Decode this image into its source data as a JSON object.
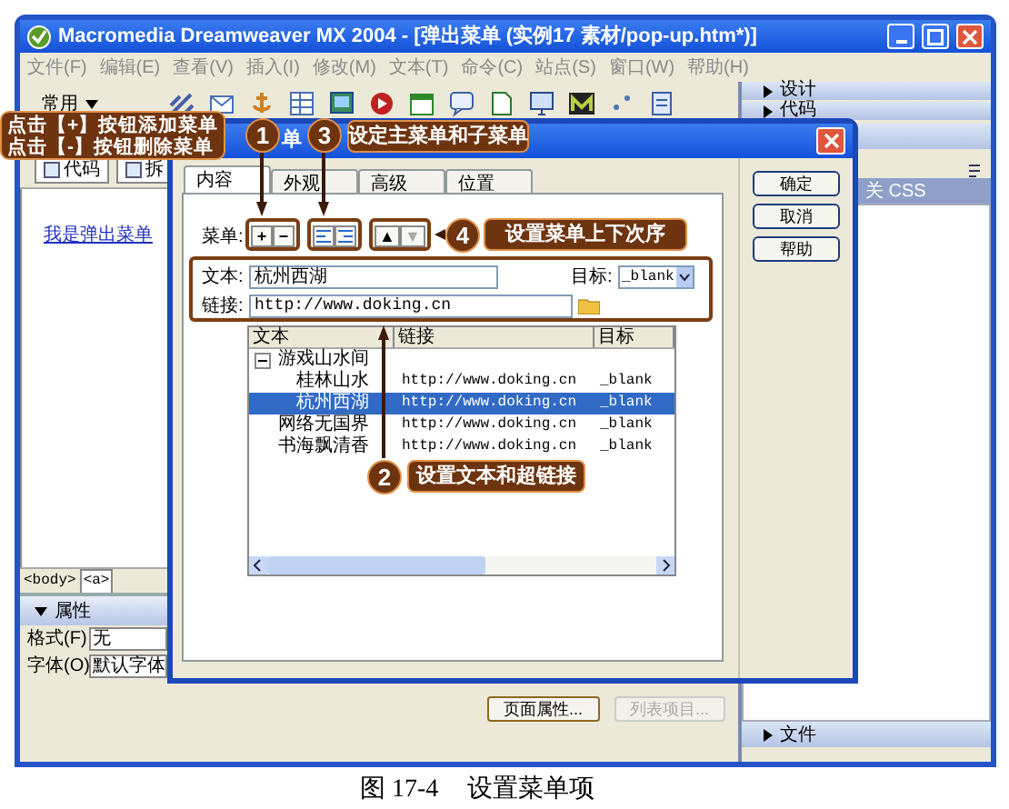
{
  "main_window": {
    "title": "Macromedia Dreamweaver MX 2004 - [弹出菜单 (实例17  素材/pop-up.htm*)]",
    "menu": [
      "文件(F)",
      "编辑(E)",
      "查看(V)",
      "插入(I)",
      "修改(M)",
      "文本(T)",
      "命令(C)",
      "站点(S)",
      "窗口(W)",
      "帮助(H)"
    ],
    "toolbar": {
      "category": "常用"
    },
    "document": {
      "view_tabs": [
        "代码",
        "拆"
      ],
      "link": "我是弹出菜单",
      "tag_selector": [
        "<body>",
        "<a>"
      ]
    },
    "properties": {
      "title": "属性",
      "rows": [
        {
          "label": "格式(F)",
          "value": "无"
        },
        {
          "label": "字体(O)",
          "value": "默认字体"
        }
      ]
    },
    "bottom_buttons": [
      {
        "label": "页面属性...",
        "disabled": false
      },
      {
        "label": "列表项目...",
        "disabled": true
      }
    ],
    "panels": [
      "设计",
      "代码"
    ],
    "panel_tab": "关 CSS",
    "files_panel": "文件"
  },
  "dialog": {
    "title": "单",
    "tabs": [
      {
        "label": "内容",
        "selected": true
      },
      {
        "label": "外观",
        "selected": false
      },
      {
        "label": "高级",
        "selected": false
      },
      {
        "label": "位置",
        "selected": false
      }
    ],
    "buttons": [
      "确定",
      "取消",
      "帮助"
    ],
    "menu_label": "菜单:",
    "add_remove": [
      "+",
      "−"
    ],
    "order_buttons": [
      {
        "glyph": "▲",
        "disabled": false
      },
      {
        "glyph": "▼",
        "disabled": true
      }
    ],
    "text_label": "文本:",
    "text_value": "杭州西湖",
    "target_label": "目标:",
    "target_value": "_blank",
    "link_label": "链接:",
    "link_value": "http://www.doking.cn",
    "tree": {
      "columns": [
        "文本",
        "链接",
        "目标"
      ],
      "rows": [
        {
          "text": "游戏山水间",
          "expanded": true,
          "selected": false,
          "children": [
            {
              "text": "桂林山水",
              "link": "http://www.doking.cn",
              "target": "_blank",
              "selected": false
            },
            {
              "text": "杭州西湖",
              "link": "http://www.doking.cn",
              "target": "_blank",
              "selected": true
            }
          ]
        },
        {
          "text": "网络无国界",
          "link": "http://www.doking.cn",
          "target": "_blank",
          "selected": false
        },
        {
          "text": "书海飘清香",
          "link": "http://www.doking.cn",
          "target": "_blank",
          "selected": false
        }
      ]
    }
  },
  "annotations": {
    "note": [
      "点击【+】按钮添加菜单",
      "点击【-】按钮删除菜单"
    ],
    "steps": [
      {
        "number": "1"
      },
      {
        "number": "3",
        "text": "设定主菜单和子菜单"
      },
      {
        "number": "4",
        "text": "设置菜单上下次序"
      },
      {
        "number": "2",
        "text": "设置文本和超链接"
      }
    ]
  },
  "caption": {
    "figure": "图 17-4",
    "text": "设置菜单项"
  }
}
